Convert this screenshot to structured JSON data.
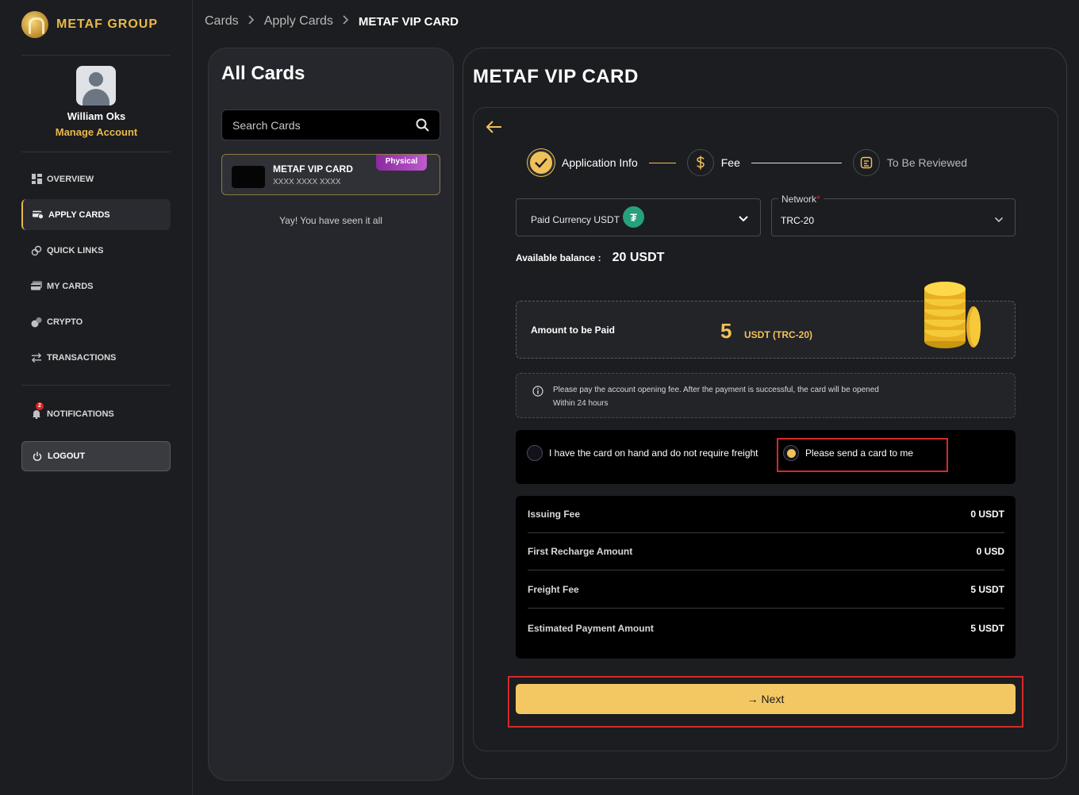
{
  "brand": {
    "name": "METAF GROUP"
  },
  "user": {
    "name": "William Oks",
    "manage_label": "Manage Account"
  },
  "nav": {
    "items": [
      {
        "label": "OVERVIEW",
        "icon": "dashboard-icon"
      },
      {
        "label": "APPLY CARDS",
        "icon": "card-add-icon",
        "active": true
      },
      {
        "label": "QUICK LINKS",
        "icon": "link-icon"
      },
      {
        "label": "MY CARDS",
        "icon": "cards-icon"
      },
      {
        "label": "CRYPTO",
        "icon": "crypto-icon"
      },
      {
        "label": "TRANSACTIONS",
        "icon": "transfer-icon"
      }
    ],
    "notifications": {
      "label": "NOTIFICATIONS",
      "count": "2"
    },
    "logout_label": "LOGOUT"
  },
  "breadcrumb": {
    "items": [
      "Cards",
      "Apply Cards"
    ],
    "current": "METAF VIP CARD"
  },
  "cards_panel": {
    "title": "All Cards",
    "search_placeholder": "Search Cards",
    "card": {
      "name": "METAF VIP CARD",
      "number": "XXXX XXXX XXXX",
      "tag": "Physical"
    },
    "end_message": "Yay! You have seen it all"
  },
  "main": {
    "title": "METAF VIP CARD",
    "steps": [
      {
        "label": "Application Info",
        "state": "done"
      },
      {
        "label": "Fee",
        "state": "current"
      },
      {
        "label": "To Be Reviewed",
        "state": "pending"
      }
    ],
    "currency": {
      "label": "Paid Currency USDT",
      "icon": "tether-icon"
    },
    "network": {
      "label": "Network",
      "required_mark": "*",
      "value": "TRC-20"
    },
    "balance": {
      "label": "Available balance :",
      "value": "20 USDT"
    },
    "amount": {
      "label": "Amount to be Paid",
      "value": "5",
      "unit": "USDT (TRC-20)"
    },
    "notice": "Please pay the account opening fee. After the payment is successful, the card will be opened Within 24 hours",
    "delivery_options": [
      {
        "label": "I have the card on hand and do not require freight",
        "selected": false
      },
      {
        "label": "Please send a card to me",
        "selected": true
      }
    ],
    "fees": [
      {
        "label": "Issuing Fee",
        "value": "0 USDT"
      },
      {
        "label": "First Recharge Amount",
        "value": "0 USD"
      },
      {
        "label": "Freight Fee",
        "value": "5 USDT"
      },
      {
        "label": "Estimated Payment Amount",
        "value": "5 USDT"
      }
    ],
    "next_label": "→ Next"
  },
  "colors": {
    "accent": "#f0c15a",
    "background": "#1c1d21",
    "highlight": "#d42a2a"
  }
}
